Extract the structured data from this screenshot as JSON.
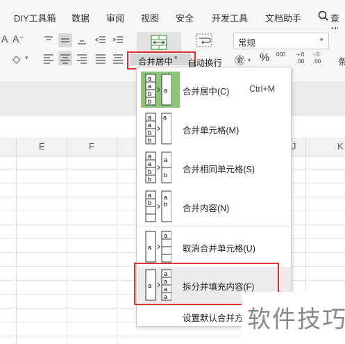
{
  "menu": {
    "tabs": [
      "DIY工具箱",
      "数据",
      "审阅",
      "视图",
      "安全",
      "开发工具",
      "文档助手"
    ],
    "search_label": "查找"
  },
  "toolbar": {
    "font_size_glyph": "A⁻",
    "merge_center_label": "合并居中",
    "wrap_text_label": "自动换行",
    "number_format_value": "常规",
    "percent_glyph": "%",
    "thousands_glyph": "000",
    "inc_decimal_glyph": "+.0 .00",
    "dec_decimal_glyph": "-.0 .00",
    "condition_label": "条"
  },
  "columns": [
    "E",
    "F",
    "J",
    "K"
  ],
  "dropdown": {
    "items": [
      {
        "label": "合并居中(C)",
        "shortcut": "Ctrl+M",
        "icon": "merge-center-icon",
        "highlighted": true
      },
      {
        "label": "合并单元格(M)",
        "shortcut": "",
        "icon": "merge-cells-icon",
        "highlighted": false
      },
      {
        "label": "合并相同单元格(S)",
        "shortcut": "",
        "icon": "merge-same-icon",
        "highlighted": false
      },
      {
        "label": "合并内容(N)",
        "shortcut": "",
        "icon": "merge-content-icon",
        "highlighted": false
      },
      {
        "label": "取消合并单元格(U)",
        "shortcut": "",
        "icon": "unmerge-icon",
        "highlighted": false
      },
      {
        "label": "拆分并填充内容(F)",
        "shortcut": "",
        "icon": "split-fill-icon",
        "highlighted": true
      },
      {
        "label": "设置默认合并方式",
        "shortcut": "",
        "icon": "",
        "highlighted": false
      }
    ]
  },
  "watermark": "软件技巧",
  "colors": {
    "accent_green": "#8cc57a",
    "highlight_red": "#e03030",
    "hover_gray": "#ececec"
  }
}
